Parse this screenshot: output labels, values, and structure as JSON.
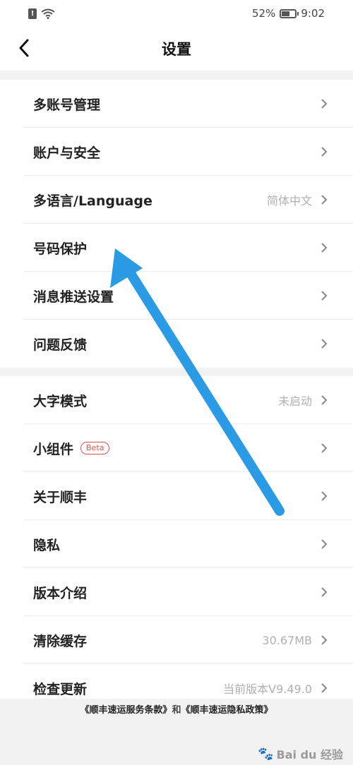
{
  "status_bar": {
    "sim_glyph": "!",
    "battery_percent": "52%",
    "battery_level": 0.52,
    "time": "9:02"
  },
  "header": {
    "back_icon": "chevron-left-icon",
    "title": "设置"
  },
  "groups": [
    {
      "items": [
        {
          "label": "多账号管理",
          "value": ""
        },
        {
          "label": "账户与安全",
          "value": ""
        },
        {
          "label": "多语言/Language",
          "value": "简体中文"
        },
        {
          "label": "号码保护",
          "value": ""
        },
        {
          "label": "消息推送设置",
          "value": ""
        },
        {
          "label": "问题反馈",
          "value": ""
        }
      ]
    },
    {
      "items": [
        {
          "label": "大字模式",
          "value": "未启动"
        },
        {
          "label": "小组件",
          "badge": "Beta",
          "value": ""
        },
        {
          "label": "关于顺丰",
          "value": ""
        },
        {
          "label": "隐私",
          "value": ""
        },
        {
          "label": "版本介绍",
          "value": ""
        },
        {
          "label": "清除缓存",
          "value": "30.67MB"
        },
        {
          "label": "检查更新",
          "value": "当前版本V9.49.0"
        }
      ]
    }
  ],
  "footer": {
    "terms_link": "《顺丰速运服务条款》",
    "separator": "和",
    "privacy_link": "《顺丰速运隐私政策》"
  },
  "watermark": {
    "text": "Bai du 经验",
    "icon": "paw-icon"
  },
  "colors": {
    "accent_arrow": "#2b9be6",
    "badge": "#e05050",
    "background": "#f2f2f2"
  }
}
